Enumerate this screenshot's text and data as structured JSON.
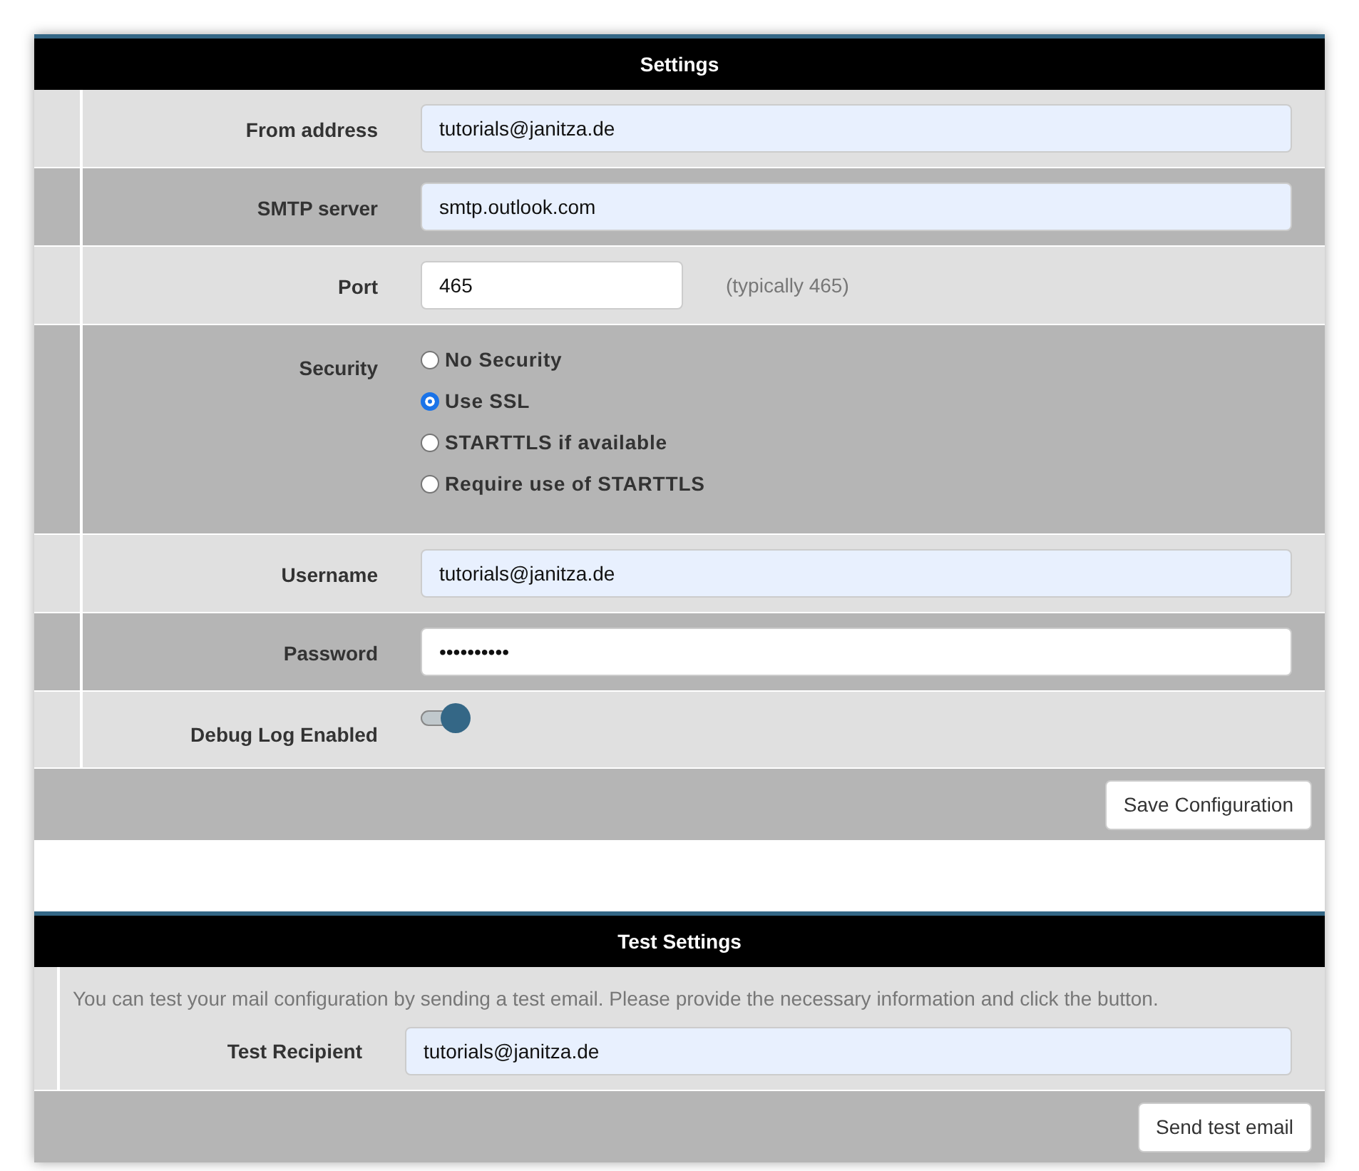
{
  "settings": {
    "title": "Settings",
    "rows": [
      {
        "kind": "text",
        "label": "From address",
        "value": "tutorials@janitza.de",
        "autofilled": true
      },
      {
        "kind": "text",
        "label": "SMTP server",
        "value": "smtp.outlook.com",
        "autofilled": true
      },
      {
        "kind": "text",
        "label": "Port",
        "value": "465",
        "autofilled": false,
        "hint": "(typically 465)"
      },
      {
        "kind": "radio",
        "label": "Security",
        "options": [
          {
            "label": "No Security",
            "selected": false
          },
          {
            "label": "Use SSL",
            "selected": true
          },
          {
            "label": "STARTTLS if available",
            "selected": false
          },
          {
            "label": "Require use of STARTTLS",
            "selected": false
          }
        ]
      },
      {
        "kind": "text",
        "label": "Username",
        "value": "tutorials@janitza.de",
        "autofilled": true
      },
      {
        "kind": "text",
        "label": "Password",
        "value": "••••••••••",
        "autofilled": false
      },
      {
        "kind": "toggle",
        "label": "Debug Log Enabled",
        "on": true
      }
    ],
    "button": "Save Configuration"
  },
  "test": {
    "title": "Test Settings",
    "description": "You can test your mail configuration by sending a test email. Please provide the necessary information and click the button.",
    "recipient": {
      "label": "Test Recipient",
      "value": "tutorials@janitza.de",
      "autofilled": true
    },
    "button": "Send test email"
  }
}
